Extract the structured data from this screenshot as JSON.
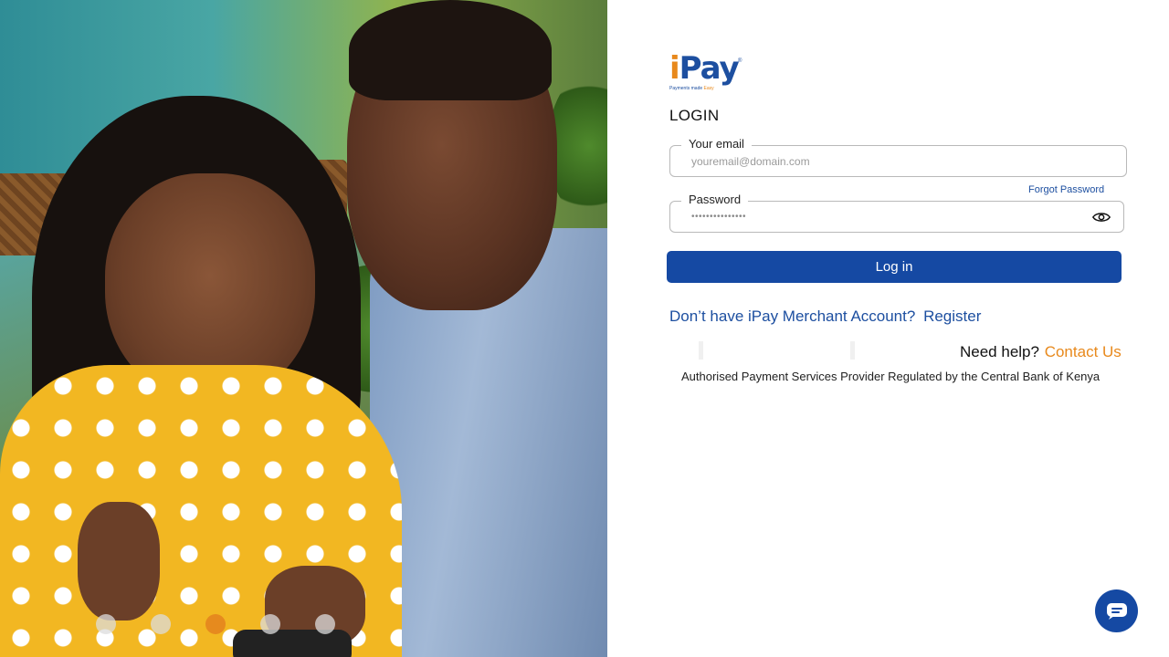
{
  "hero": {
    "image_description": "photo-woman-and-man-looking-at-phone",
    "carousel": {
      "slide_count": 5,
      "active_index": 2,
      "active_color": "#e68a1e"
    }
  },
  "brand": {
    "logo_i": "i",
    "logo_pay": "Pay",
    "logo_reg": "®",
    "tagline_prefix": "Payments made ",
    "tagline_accent": "Easy",
    "primary_color": "#1549a3",
    "accent_color": "#e8891c"
  },
  "login": {
    "title": "LOGIN",
    "email": {
      "label": "Your email",
      "placeholder": "youremail@domain.com",
      "value": ""
    },
    "password": {
      "label": "Password",
      "masked_value": "•••••••••••••••",
      "forgot_label": "Forgot Password",
      "toggle_icon": "eye-icon"
    },
    "submit_label": "Log in"
  },
  "register": {
    "prompt": "Don’t have iPay Merchant Account?",
    "link": "Register"
  },
  "help": {
    "prompt": "Need help?",
    "link": "Contact Us"
  },
  "footer": {
    "authorised_text": "Authorised Payment Services Provider Regulated by the Central Bank of Kenya"
  },
  "chat": {
    "icon": "chat-icon"
  }
}
